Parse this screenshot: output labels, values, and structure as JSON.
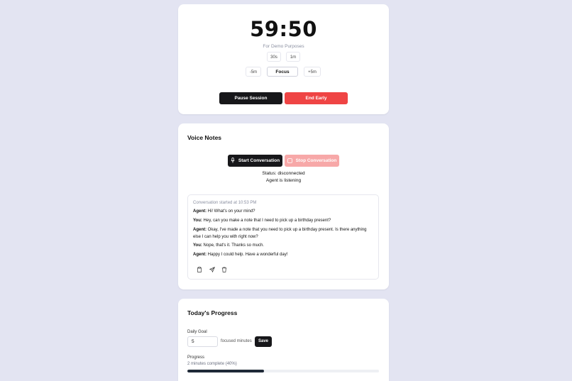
{
  "timer": {
    "time": "59:50",
    "demo_label": "For Demo Purposes",
    "presets": [
      "30s",
      "1m"
    ],
    "adjust_minus": "-5m",
    "mode": "Focus",
    "adjust_plus": "+5m",
    "pause_label": "Pause Session",
    "end_label": "End Early"
  },
  "voice": {
    "title": "Voice Notes",
    "start_label": "Start Conversation",
    "stop_label": "Stop Conversation",
    "status": "Status: disconnected",
    "agent_state": "Agent is listening",
    "conversation": {
      "started": "Conversation started at 10:53 PM",
      "messages": [
        {
          "speaker": "Agent:",
          "text": " Hi! What's on your mind?"
        },
        {
          "speaker": "You:",
          "text": " Hey, can you make a note that I need to pick up a birthday present?"
        },
        {
          "speaker": "Agent:",
          "text": " Okay, I've made a note that you need to pick up a birthday present. Is there anything else I can help you with right now?"
        },
        {
          "speaker": "You:",
          "text": " Nope, that's it. Thanks so much."
        },
        {
          "speaker": "Agent:",
          "text": " Happy I could help. Have a wonderful day!"
        }
      ]
    },
    "icons": [
      "clipboard-icon",
      "send-icon",
      "trash-icon"
    ]
  },
  "progress": {
    "title": "Today's Progress",
    "daily_goal_label": "Daily Goal",
    "goal_value": "5",
    "goal_suffix": "focused minutes",
    "save_label": "Save",
    "progress_label": "Progress",
    "progress_text": "2 minutes complete (40%)",
    "progress_fraction": 0.4
  },
  "colors": {
    "background": "#e3e4f2",
    "dark_button": "#17171a",
    "danger": "#ef4444",
    "danger_disabled": "#f7a8a8",
    "progress_fill": "#1f2937"
  }
}
